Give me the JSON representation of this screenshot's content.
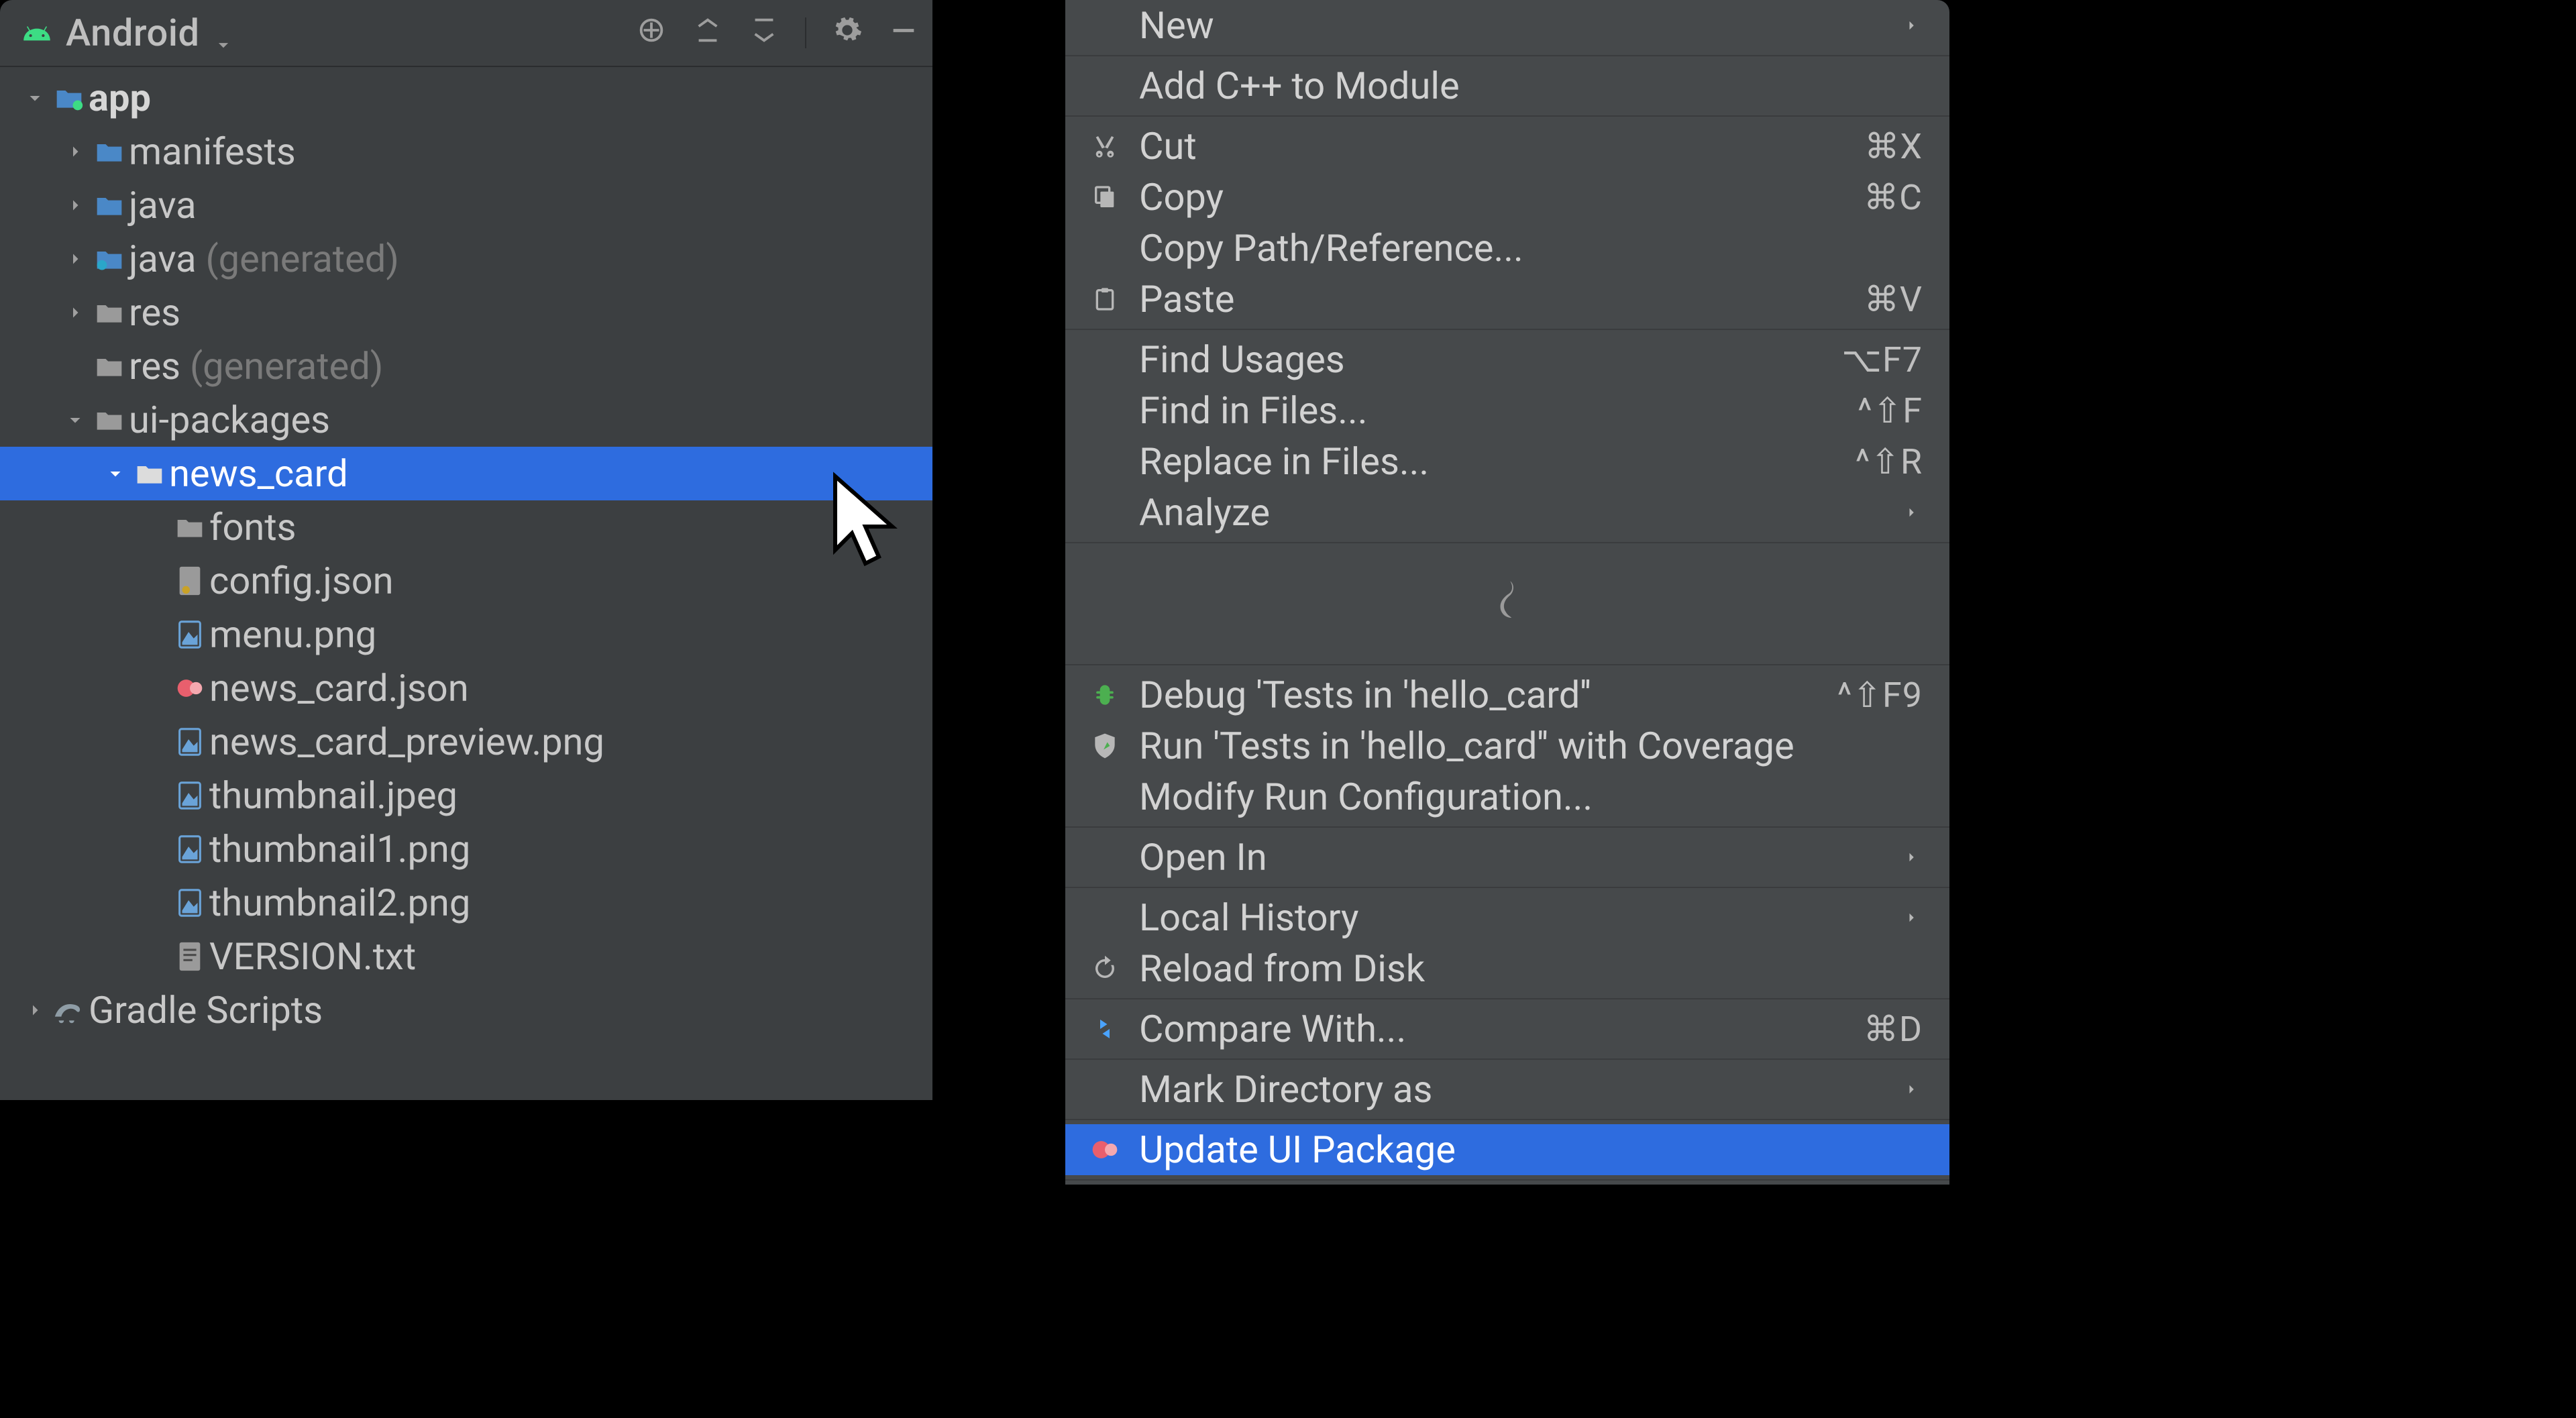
{
  "project": {
    "view_label": "Android",
    "tree": {
      "app": "app",
      "manifests": "manifests",
      "java": "java",
      "java_gen": "java",
      "java_gen_suffix": " (generated)",
      "res": "res",
      "res_gen": "res",
      "res_gen_suffix": " (generated)",
      "ui_packages": "ui-packages",
      "news_card": "news_card",
      "fonts": "fonts",
      "config_json": "config.json",
      "menu_png": "menu.png",
      "news_card_json": "news_card.json",
      "news_card_preview": "news_card_preview.png",
      "thumbnail_jpeg": "thumbnail.jpeg",
      "thumbnail1_png": "thumbnail1.png",
      "thumbnail2_png": "thumbnail2.png",
      "version_txt": "VERSION.txt",
      "gradle_scripts": "Gradle Scripts"
    }
  },
  "menu": {
    "new": "New",
    "add_cpp": "Add C++ to Module",
    "cut": "Cut",
    "cut_sc": "⌘X",
    "copy": "Copy",
    "copy_sc": "⌘C",
    "copy_path": "Copy Path/Reference...",
    "paste": "Paste",
    "paste_sc": "⌘V",
    "find_usages": "Find Usages",
    "find_usages_sc": "⌥F7",
    "find_in_files": "Find in Files...",
    "find_in_files_sc": "^⇧F",
    "replace_in_files": "Replace in Files...",
    "replace_in_files_sc": "^⇧R",
    "analyze": "Analyze",
    "debug_tests": "Debug 'Tests in 'hello_card''",
    "debug_tests_sc": "^⇧F9",
    "run_coverage": "Run 'Tests in 'hello_card'' with Coverage",
    "modify_run": "Modify Run Configuration...",
    "open_in": "Open In",
    "local_history": "Local History",
    "reload": "Reload from Disk",
    "compare_with": "Compare With...",
    "compare_with_sc": "⌘D",
    "mark_dir": "Mark Directory as",
    "update_ui": "Update UI Package"
  }
}
